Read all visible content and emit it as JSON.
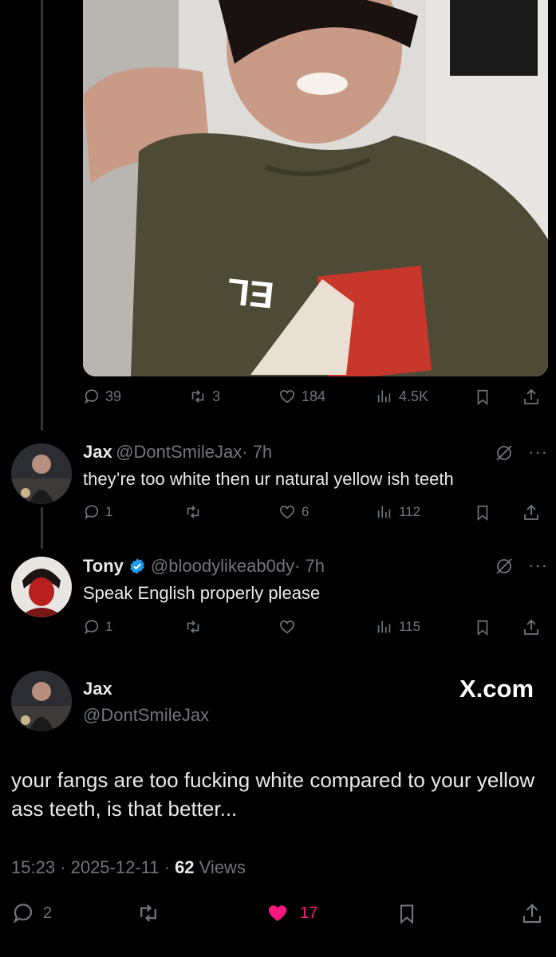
{
  "main_post": {
    "stats": {
      "replies": "39",
      "reposts": "3",
      "likes": "184",
      "views": "4.5K"
    }
  },
  "replies": [
    {
      "name": "Jax",
      "handle": "@DontSmileJax",
      "time": "· 7h",
      "text": "they’re too white then ur natural yellow ish teeth",
      "stats": {
        "replies": "1",
        "likes": "6",
        "views": "112"
      }
    },
    {
      "name": "Tony",
      "handle": "@bloodylikeab0dy",
      "time": "· 7h",
      "text": "Speak English properly please",
      "stats": {
        "replies": "1",
        "views": "115"
      }
    }
  ],
  "focused_post": {
    "name": "Jax",
    "handle": "@DontSmileJax",
    "watermark": "X.com",
    "text": "your fangs are too fucking white compared to your yellow ass teeth, is that better...",
    "timestamp": "15:23 · 2025-12-11 · ",
    "views_count": "62",
    "views_label": " Views",
    "stats": {
      "replies": "2",
      "likes": "17"
    }
  },
  "colors": {
    "background": "#000000",
    "muted": "#71767b",
    "like_active": "#f91880",
    "verified": "#1d9bf0"
  }
}
